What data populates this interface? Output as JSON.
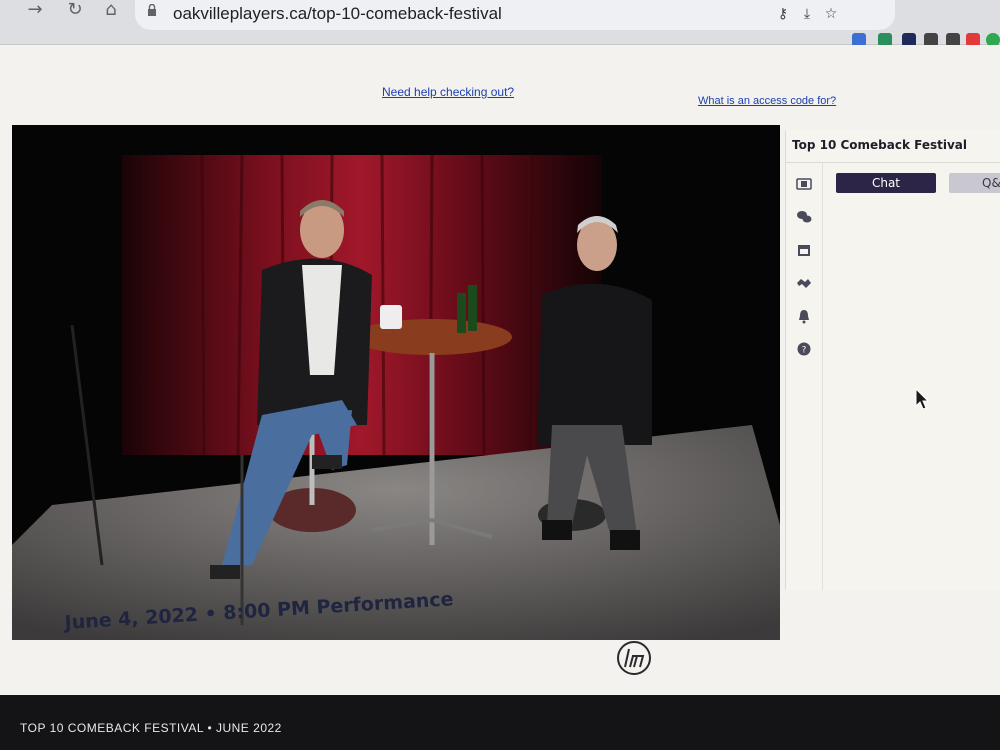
{
  "browser": {
    "url": "oakvilleplayers.ca/top-10-comeback-festival",
    "icons": [
      "back-icon",
      "reload-icon",
      "home-icon",
      "lock-icon",
      "key-icon",
      "install-icon",
      "star-icon"
    ],
    "extension_colors": [
      "#3b6fd4",
      "#2a8f5a",
      "#e0413a",
      "#1f2a5a",
      "#444444",
      "#e23a3a",
      "#2fa84f"
    ]
  },
  "page": {
    "help_link": "Need help checking out?",
    "access_code_link": "What is an access code for?",
    "performance_title": "June 4, 2022 • 8:00 PM Performance"
  },
  "side_panel": {
    "title": "Top 10 Comeback Festival",
    "tabs": [
      {
        "label": "Chat",
        "active": true
      },
      {
        "label": "Q&A",
        "active": false
      }
    ],
    "rail_icons": [
      "film-icon",
      "chat-bubbles-icon",
      "calendar-icon",
      "handshake-icon",
      "bell-icon",
      "help-icon"
    ]
  },
  "caption": "TOP 10 COMEBACK FESTIVAL • JUNE 2022",
  "colors": {
    "page_bg": "#f3f2ee",
    "accent_dark": "#2c2547",
    "link": "#1a3fb0",
    "title_text": "#1f2440",
    "curtain": "#7a0f1e"
  }
}
